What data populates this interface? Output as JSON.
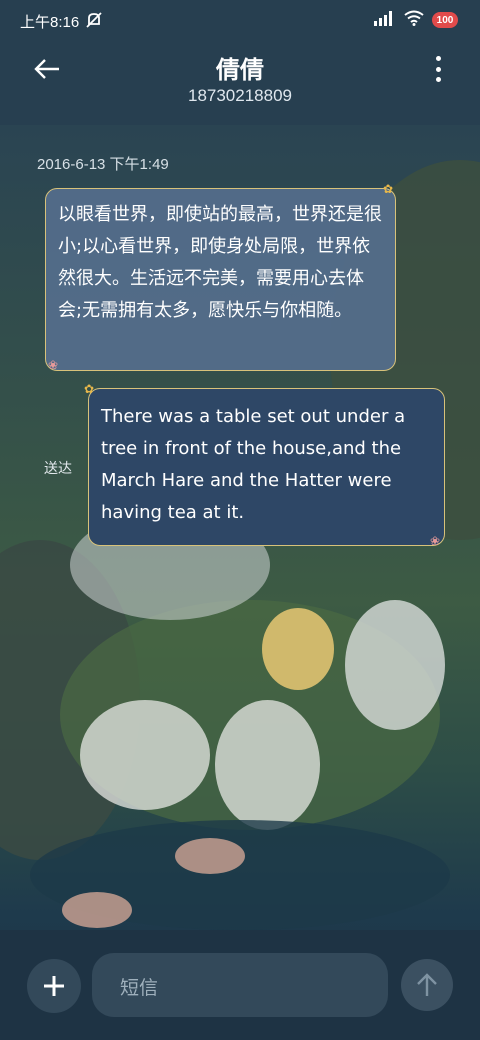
{
  "status_bar": {
    "time": "上午8:16",
    "battery": "100"
  },
  "header": {
    "contact_name": "倩倩",
    "phone_number": "18730218809"
  },
  "conversation": {
    "timestamp": "2016-6-13 下午1:49",
    "messages": [
      {
        "direction": "incoming",
        "text": "以眼看世界，即使站的最高，世界还是很小;以心看世界，即使身处局限，世界依然很大。生活远不完美，需要用心去体会;无需拥有太多，愿快乐与你相随。"
      },
      {
        "direction": "outgoing",
        "text": "There was a table set out under a tree in front of the house,and the March Hare and the Hatter were having tea at it.",
        "status": "送达"
      }
    ]
  },
  "composer": {
    "placeholder": "短信"
  },
  "icons": [
    "back-arrow-icon",
    "more-vert-icon",
    "mute-icon",
    "signal-icon",
    "wifi-icon",
    "battery-icon",
    "plus-icon",
    "send-arrow-icon"
  ]
}
